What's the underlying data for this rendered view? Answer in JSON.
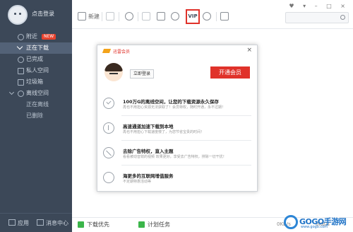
{
  "sidebar": {
    "profile": {
      "login_text": "点击登录"
    },
    "items": [
      {
        "label": "附近",
        "badge": "NEW",
        "icon": "location-icon",
        "active": false
      },
      {
        "label": "正在下载",
        "icon": "download-icon",
        "active": true
      },
      {
        "label": "已完成",
        "icon": "check-icon",
        "active": false
      },
      {
        "label": "私人空间",
        "icon": "lock-icon",
        "active": false
      },
      {
        "label": "垃圾箱",
        "icon": "trash-icon",
        "active": false
      },
      {
        "label": "离线空间",
        "icon": "cloud-icon",
        "active": false,
        "expanded": true
      },
      {
        "label": "正在离线",
        "sub": true
      },
      {
        "label": "已删除",
        "sub": true
      }
    ],
    "bottom": {
      "apps_label": "应用",
      "messages_label": "消息中心"
    }
  },
  "toolbar": {
    "new_label": "新建",
    "vip_label": "VIP",
    "search_placeholder": "",
    "window_controls": "♥ ▾ – □ ×"
  },
  "dialog": {
    "title": "迅雷会员",
    "close": "×",
    "login_button": "立即登录",
    "open_vip_button": "开通会员",
    "benefits": [
      {
        "title": "100万G的离线空间，让您的下载资源永久保存",
        "subtitle": "再也不用担心资源无法获取了！会员特权，随时开通，永不过期！",
        "icon": "check-circle-icon"
      },
      {
        "title": "高速通道加速下载到本地",
        "subtitle": "再也不用担心下载速度慢了，为您节省宝贵的时间！",
        "icon": "download-circle-icon"
      },
      {
        "title": "去除广告特权，直入主题",
        "subtitle": "看看被动音效的视频 效果更好，享受去广告特权，排除一切干扰！",
        "icon": "ban-icon"
      },
      {
        "title": "海更多的互联网增值服务",
        "subtitle": "不定期特惠活动等",
        "icon": "yen-icon"
      }
    ],
    "accent_color": "#e0322a"
  },
  "statusbar": {
    "left_label": "下载优先",
    "task_label": "计划任务",
    "speed_down": "0KB/s",
    "speed_up": "0KB/s"
  },
  "watermark": {
    "text": "GOGO手游网",
    "sub": "www.gogo.com"
  }
}
